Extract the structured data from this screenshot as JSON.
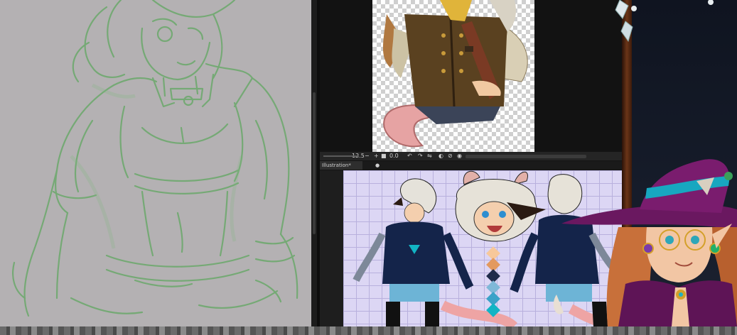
{
  "nav_toolbar": {
    "zoom": "12.5",
    "minus": "−",
    "plus": "+",
    "rotation": "0.0"
  },
  "illustration_tab": {
    "label": "Illustration*",
    "close": "●"
  },
  "colors": {
    "sketch_line": "#6fa96f",
    "canvas_gray": "#b4b1b3",
    "hoodie_navy": "#14244a",
    "accent_cyan": "#12b4c4",
    "hat_purple": "#6a1860"
  },
  "palette_swatches": [
    "#f7c89a",
    "#e3995e",
    "#1f2b4a",
    "#7fb8d8",
    "#3aa2c8",
    "#12b4c4"
  ]
}
